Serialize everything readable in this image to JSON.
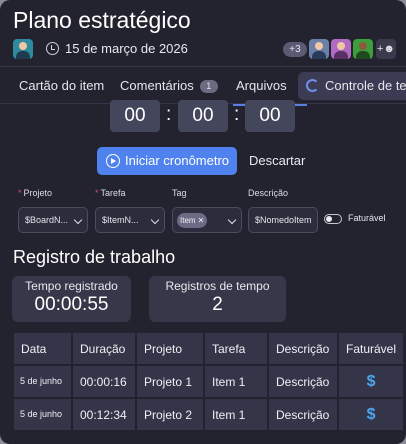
{
  "header": {
    "title": "Plano estratégico",
    "date": "15 de março de 2026",
    "extra_members": "+3"
  },
  "tabs": [
    {
      "label": "Cartão do item"
    },
    {
      "label": "Comentários",
      "count": "1"
    },
    {
      "label": "Arquivos"
    },
    {
      "label": "Controle de tempo",
      "active": true
    }
  ],
  "timer": {
    "hours": "00",
    "minutes": "00",
    "seconds": "00"
  },
  "actions": {
    "start_label": "Iniciar cronômetro",
    "discard_label": "Descartar"
  },
  "fields": {
    "projeto": {
      "label": "Projeto",
      "value": "$BoardN...",
      "required": true
    },
    "tarefa": {
      "label": "Tarefa",
      "value": "$ItemN...",
      "required": true
    },
    "tag": {
      "label": "Tag",
      "chip": "Item"
    },
    "descricao": {
      "label": "Descrição",
      "value": "$NomedoItem"
    },
    "faturavel": {
      "label": "Faturável",
      "on": false
    }
  },
  "log": {
    "title": "Registro de trabalho",
    "stats": [
      {
        "label": "Tempo registrado",
        "value": "00:00:55"
      },
      {
        "label": "Registros de tempo",
        "value": "2"
      }
    ],
    "columns": [
      "Data",
      "Duração",
      "Projeto",
      "Tarefa",
      "Descrição",
      "Faturável"
    ],
    "rows": [
      {
        "data": "5 de junho",
        "duracao": "00:00:16",
        "projeto": "Projeto 1",
        "tarefa": "Item 1",
        "descricao": "Descrição",
        "faturavel": "$"
      },
      {
        "data": "5 de junho",
        "duracao": "00:12:34",
        "projeto": "Projeto 2",
        "tarefa": "Item 1",
        "descricao": "Descrição",
        "faturavel": "$"
      }
    ]
  },
  "colors": {
    "accent": "#4f82ef",
    "background": "#23232f",
    "billable": "#4aa6ee",
    "required": "#e0457a"
  }
}
